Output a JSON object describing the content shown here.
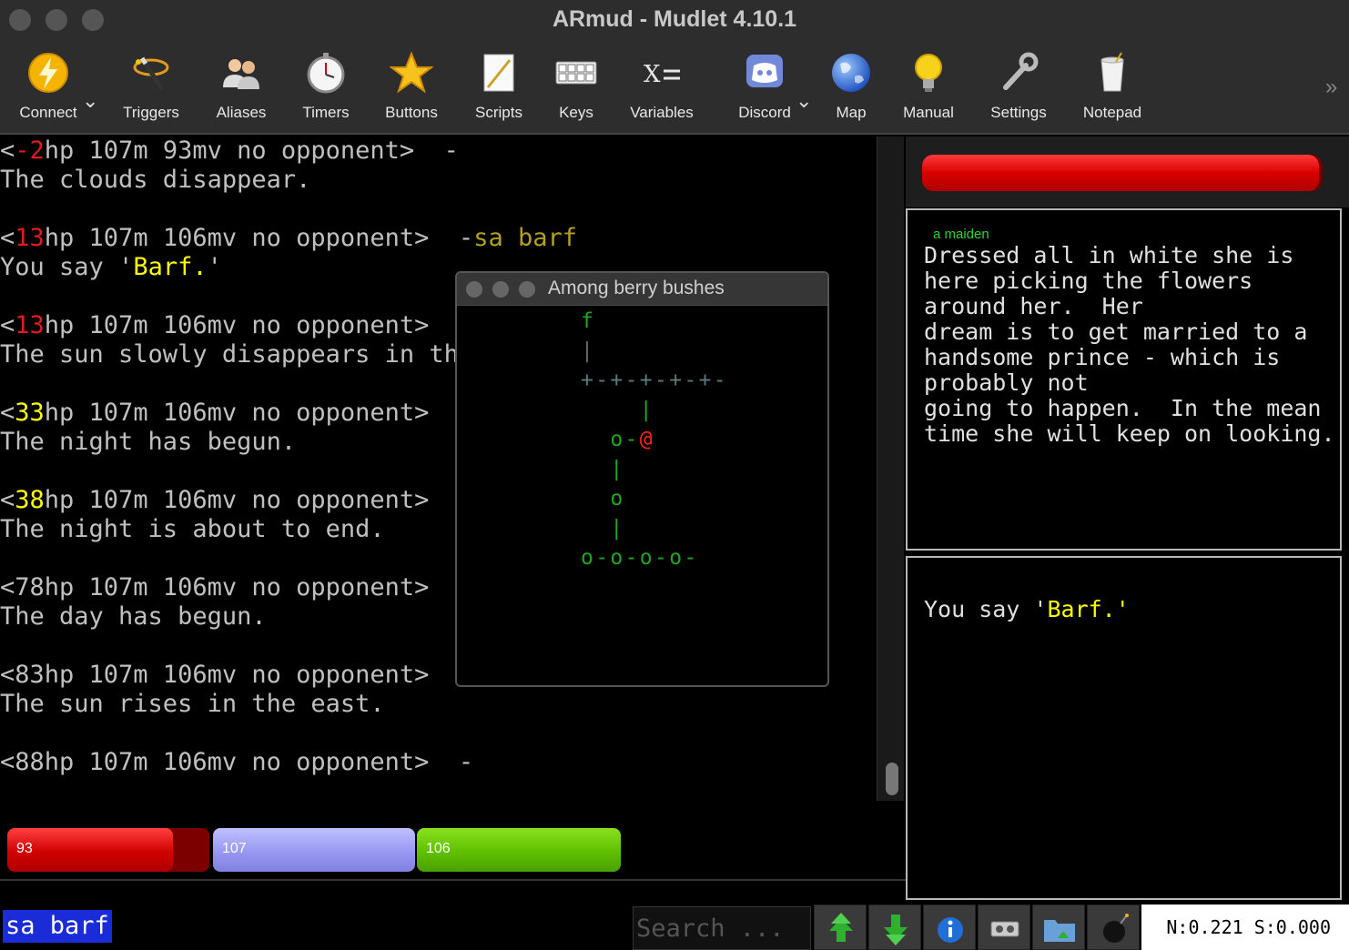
{
  "window": {
    "title": "ARmud - Mudlet 4.10.1"
  },
  "toolbar": {
    "items": [
      {
        "label": "Connect",
        "icon": "lightning-icon"
      },
      {
        "label": "Triggers",
        "icon": "wand-icon"
      },
      {
        "label": "Aliases",
        "icon": "people-icon"
      },
      {
        "label": "Timers",
        "icon": "stopwatch-icon"
      },
      {
        "label": "Buttons",
        "icon": "star-icon"
      },
      {
        "label": "Scripts",
        "icon": "pen-paper-icon"
      },
      {
        "label": "Keys",
        "icon": "keyboard-icon"
      },
      {
        "label": "Variables",
        "icon": "variables-icon"
      },
      {
        "label": "Discord",
        "icon": "discord-icon"
      },
      {
        "label": "Map",
        "icon": "globe-icon"
      },
      {
        "label": "Manual",
        "icon": "lightbulb-icon"
      },
      {
        "label": "Settings",
        "icon": "wrench-icon"
      },
      {
        "label": "Notepad",
        "icon": "notepad-icon"
      }
    ]
  },
  "console": {
    "lines": [
      [
        {
          "t": "<",
          "c": ""
        },
        {
          "t": "-2",
          "c": "c-red"
        },
        {
          "t": "hp 107m 93mv no opponent>  -",
          "c": ""
        }
      ],
      [
        {
          "t": "The clouds disappear.",
          "c": ""
        }
      ],
      [
        {
          "t": "",
          "c": ""
        }
      ],
      [
        {
          "t": "<",
          "c": ""
        },
        {
          "t": "13",
          "c": "c-red"
        },
        {
          "t": "hp 107m 106mv no opponent>  -",
          "c": ""
        },
        {
          "t": "sa barf",
          "c": "c-olive"
        }
      ],
      [
        {
          "t": "You say '",
          "c": ""
        },
        {
          "t": "Barf.",
          "c": "c-yellow"
        },
        {
          "t": "'",
          "c": ""
        }
      ],
      [
        {
          "t": "",
          "c": ""
        }
      ],
      [
        {
          "t": "<",
          "c": ""
        },
        {
          "t": "13",
          "c": "c-red"
        },
        {
          "t": "hp 107m 106mv no opponent>  -",
          "c": ""
        }
      ],
      [
        {
          "t": "The sun slowly disappears in the west.",
          "c": ""
        }
      ],
      [
        {
          "t": "",
          "c": ""
        }
      ],
      [
        {
          "t": "<",
          "c": ""
        },
        {
          "t": "33",
          "c": "c-yellow"
        },
        {
          "t": "hp 107m 106mv no opponent>  -",
          "c": ""
        }
      ],
      [
        {
          "t": "The night has begun.",
          "c": ""
        }
      ],
      [
        {
          "t": "",
          "c": ""
        }
      ],
      [
        {
          "t": "<",
          "c": ""
        },
        {
          "t": "38",
          "c": "c-yellow"
        },
        {
          "t": "hp 107m 106mv no opponent>  -",
          "c": ""
        }
      ],
      [
        {
          "t": "The night is about to end.",
          "c": ""
        }
      ],
      [
        {
          "t": "",
          "c": ""
        }
      ],
      [
        {
          "t": "<78hp 107m 106mv no opponent>  -",
          "c": ""
        }
      ],
      [
        {
          "t": "The day has begun.",
          "c": ""
        }
      ],
      [
        {
          "t": "",
          "c": ""
        }
      ],
      [
        {
          "t": "<83hp 107m 106mv no opponent>  -",
          "c": ""
        }
      ],
      [
        {
          "t": "The sun rises in the east.",
          "c": ""
        }
      ],
      [
        {
          "t": "",
          "c": ""
        }
      ],
      [
        {
          "t": "<88hp 107m 106mv no opponent>  -",
          "c": ""
        }
      ]
    ]
  },
  "mapwindow": {
    "title": "Among berry bushes",
    "rows": [
      {
        "text": "     f",
        "color": "#1fa51f"
      },
      {
        "text": "     |",
        "color": "#5a6b6b"
      },
      {
        "text": "     +-+-+-+-+-",
        "color": "#5a7b7b"
      },
      {
        "text": "         |",
        "color": "#1fa51f"
      },
      {
        "text": "       o-@",
        "color": "#1fa51f",
        "player": "@"
      },
      {
        "text": "       |",
        "color": "#1fa51f"
      },
      {
        "text": "       o",
        "color": "#1fa51f"
      },
      {
        "text": "       |",
        "color": "#1fa51f"
      },
      {
        "text": "     o-o-o-o-",
        "color": "#1fa51f"
      }
    ]
  },
  "gauges": {
    "hp": {
      "value": "93",
      "fraction": 0.82,
      "color": "#d10000"
    },
    "mana": {
      "value": "107",
      "fraction": 1.0,
      "color": "#9b9bf5"
    },
    "moves": {
      "value": "106",
      "fraction": 1.0,
      "color": "#5fc000"
    }
  },
  "enemy_hp": {
    "fraction": 0.99
  },
  "description": {
    "name": "a maiden",
    "lines": [
      "Dressed all in white she is",
      "here picking the flowers",
      "around her.  Her",
      "dream is to get married to a",
      "handsome prince - which is",
      "probably not",
      "going to happen.  In the mean",
      "time she will keep on looking."
    ]
  },
  "chat": {
    "prefix": "You say '",
    "speech": "Barf.",
    "suffix": "'"
  },
  "input": {
    "command": "sa barf"
  },
  "search": {
    "placeholder": "Search ..."
  },
  "bottom_buttons": [
    {
      "name": "scroll-up-button",
      "icon": "up-arrow-icon"
    },
    {
      "name": "scroll-down-button",
      "icon": "down-arrow-icon"
    },
    {
      "name": "info-button",
      "icon": "info-icon"
    },
    {
      "name": "replay-button",
      "icon": "tape-icon"
    },
    {
      "name": "log-button",
      "icon": "folder-download-icon"
    },
    {
      "name": "emergency-stop-button",
      "icon": "bomb-icon"
    }
  ],
  "status": {
    "text": "N:0.221 S:0.000"
  }
}
